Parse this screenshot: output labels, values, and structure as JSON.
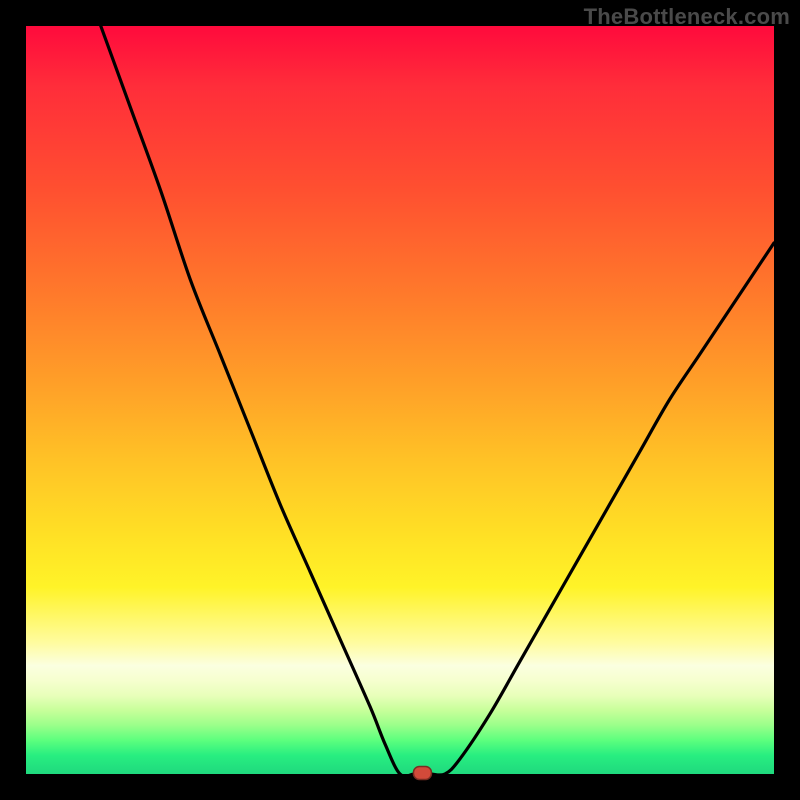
{
  "watermark": "TheBottleneck.com",
  "colors": {
    "frame": "#000000",
    "curve": "#000000",
    "marker_fill": "#d24a3a",
    "marker_stroke": "#7a2c22"
  },
  "chart_data": {
    "type": "line",
    "title": "",
    "xlabel": "",
    "ylabel": "",
    "xlim": [
      0,
      100
    ],
    "ylim": [
      0,
      100
    ],
    "grid": false,
    "legend": false,
    "series": [
      {
        "name": "curve",
        "x": [
          10,
          14,
          18,
          22,
          26,
          30,
          34,
          38,
          42,
          46,
          48,
          50,
          52,
          54,
          56,
          58,
          62,
          66,
          70,
          74,
          78,
          82,
          86,
          90,
          94,
          100
        ],
        "values": [
          100,
          89,
          78,
          66,
          56,
          46,
          36,
          27,
          18,
          9,
          4,
          0,
          0,
          0,
          0,
          2,
          8,
          15,
          22,
          29,
          36,
          43,
          50,
          56,
          62,
          71
        ]
      }
    ],
    "annotations": [
      {
        "name": "optimal-point",
        "x": 53,
        "y": 0
      }
    ]
  }
}
